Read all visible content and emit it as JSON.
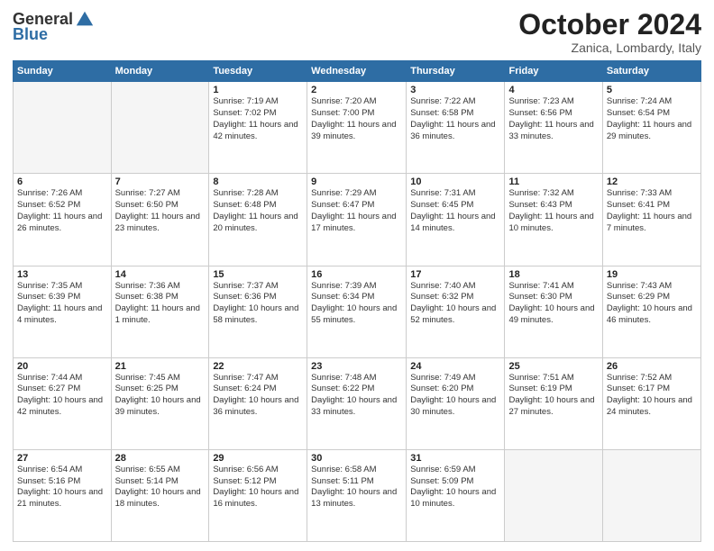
{
  "logo": {
    "general": "General",
    "blue": "Blue"
  },
  "title": "October 2024",
  "subtitle": "Zanica, Lombardy, Italy",
  "headers": [
    "Sunday",
    "Monday",
    "Tuesday",
    "Wednesday",
    "Thursday",
    "Friday",
    "Saturday"
  ],
  "weeks": [
    [
      {
        "day": "",
        "text": ""
      },
      {
        "day": "",
        "text": ""
      },
      {
        "day": "1",
        "text": "Sunrise: 7:19 AM\nSunset: 7:02 PM\nDaylight: 11 hours and 42 minutes."
      },
      {
        "day": "2",
        "text": "Sunrise: 7:20 AM\nSunset: 7:00 PM\nDaylight: 11 hours and 39 minutes."
      },
      {
        "day": "3",
        "text": "Sunrise: 7:22 AM\nSunset: 6:58 PM\nDaylight: 11 hours and 36 minutes."
      },
      {
        "day": "4",
        "text": "Sunrise: 7:23 AM\nSunset: 6:56 PM\nDaylight: 11 hours and 33 minutes."
      },
      {
        "day": "5",
        "text": "Sunrise: 7:24 AM\nSunset: 6:54 PM\nDaylight: 11 hours and 29 minutes."
      }
    ],
    [
      {
        "day": "6",
        "text": "Sunrise: 7:26 AM\nSunset: 6:52 PM\nDaylight: 11 hours and 26 minutes."
      },
      {
        "day": "7",
        "text": "Sunrise: 7:27 AM\nSunset: 6:50 PM\nDaylight: 11 hours and 23 minutes."
      },
      {
        "day": "8",
        "text": "Sunrise: 7:28 AM\nSunset: 6:48 PM\nDaylight: 11 hours and 20 minutes."
      },
      {
        "day": "9",
        "text": "Sunrise: 7:29 AM\nSunset: 6:47 PM\nDaylight: 11 hours and 17 minutes."
      },
      {
        "day": "10",
        "text": "Sunrise: 7:31 AM\nSunset: 6:45 PM\nDaylight: 11 hours and 14 minutes."
      },
      {
        "day": "11",
        "text": "Sunrise: 7:32 AM\nSunset: 6:43 PM\nDaylight: 11 hours and 10 minutes."
      },
      {
        "day": "12",
        "text": "Sunrise: 7:33 AM\nSunset: 6:41 PM\nDaylight: 11 hours and 7 minutes."
      }
    ],
    [
      {
        "day": "13",
        "text": "Sunrise: 7:35 AM\nSunset: 6:39 PM\nDaylight: 11 hours and 4 minutes."
      },
      {
        "day": "14",
        "text": "Sunrise: 7:36 AM\nSunset: 6:38 PM\nDaylight: 11 hours and 1 minute."
      },
      {
        "day": "15",
        "text": "Sunrise: 7:37 AM\nSunset: 6:36 PM\nDaylight: 10 hours and 58 minutes."
      },
      {
        "day": "16",
        "text": "Sunrise: 7:39 AM\nSunset: 6:34 PM\nDaylight: 10 hours and 55 minutes."
      },
      {
        "day": "17",
        "text": "Sunrise: 7:40 AM\nSunset: 6:32 PM\nDaylight: 10 hours and 52 minutes."
      },
      {
        "day": "18",
        "text": "Sunrise: 7:41 AM\nSunset: 6:30 PM\nDaylight: 10 hours and 49 minutes."
      },
      {
        "day": "19",
        "text": "Sunrise: 7:43 AM\nSunset: 6:29 PM\nDaylight: 10 hours and 46 minutes."
      }
    ],
    [
      {
        "day": "20",
        "text": "Sunrise: 7:44 AM\nSunset: 6:27 PM\nDaylight: 10 hours and 42 minutes."
      },
      {
        "day": "21",
        "text": "Sunrise: 7:45 AM\nSunset: 6:25 PM\nDaylight: 10 hours and 39 minutes."
      },
      {
        "day": "22",
        "text": "Sunrise: 7:47 AM\nSunset: 6:24 PM\nDaylight: 10 hours and 36 minutes."
      },
      {
        "day": "23",
        "text": "Sunrise: 7:48 AM\nSunset: 6:22 PM\nDaylight: 10 hours and 33 minutes."
      },
      {
        "day": "24",
        "text": "Sunrise: 7:49 AM\nSunset: 6:20 PM\nDaylight: 10 hours and 30 minutes."
      },
      {
        "day": "25",
        "text": "Sunrise: 7:51 AM\nSunset: 6:19 PM\nDaylight: 10 hours and 27 minutes."
      },
      {
        "day": "26",
        "text": "Sunrise: 7:52 AM\nSunset: 6:17 PM\nDaylight: 10 hours and 24 minutes."
      }
    ],
    [
      {
        "day": "27",
        "text": "Sunrise: 6:54 AM\nSunset: 5:16 PM\nDaylight: 10 hours and 21 minutes."
      },
      {
        "day": "28",
        "text": "Sunrise: 6:55 AM\nSunset: 5:14 PM\nDaylight: 10 hours and 18 minutes."
      },
      {
        "day": "29",
        "text": "Sunrise: 6:56 AM\nSunset: 5:12 PM\nDaylight: 10 hours and 16 minutes."
      },
      {
        "day": "30",
        "text": "Sunrise: 6:58 AM\nSunset: 5:11 PM\nDaylight: 10 hours and 13 minutes."
      },
      {
        "day": "31",
        "text": "Sunrise: 6:59 AM\nSunset: 5:09 PM\nDaylight: 10 hours and 10 minutes."
      },
      {
        "day": "",
        "text": ""
      },
      {
        "day": "",
        "text": ""
      }
    ]
  ]
}
